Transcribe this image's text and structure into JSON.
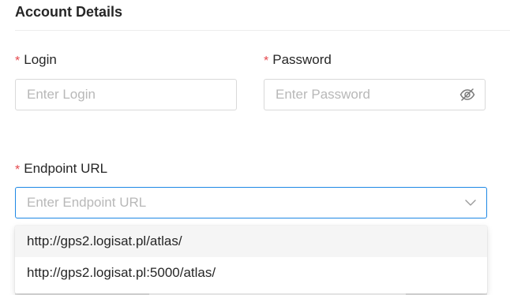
{
  "section": {
    "title": "Account Details"
  },
  "login": {
    "required_mark": "*",
    "label": "Login",
    "placeholder": "Enter Login",
    "value": ""
  },
  "password": {
    "required_mark": "*",
    "label": "Password",
    "placeholder": "Enter Password",
    "value": "",
    "toggle_icon": "eye-slash-icon"
  },
  "endpoint": {
    "required_mark": "*",
    "label": "Endpoint URL",
    "placeholder": "Enter Endpoint URL",
    "value": "",
    "chevron_icon": "chevron-down-icon",
    "options": [
      "http://gps2.logisat.pl/atlas/",
      "http://gps2.logisat.pl:5000/atlas/"
    ]
  },
  "colors": {
    "required": "#e5484d",
    "focus_border": "#1e88e5",
    "placeholder": "#b8b8b8",
    "option_hover": "#f5f5f5"
  }
}
